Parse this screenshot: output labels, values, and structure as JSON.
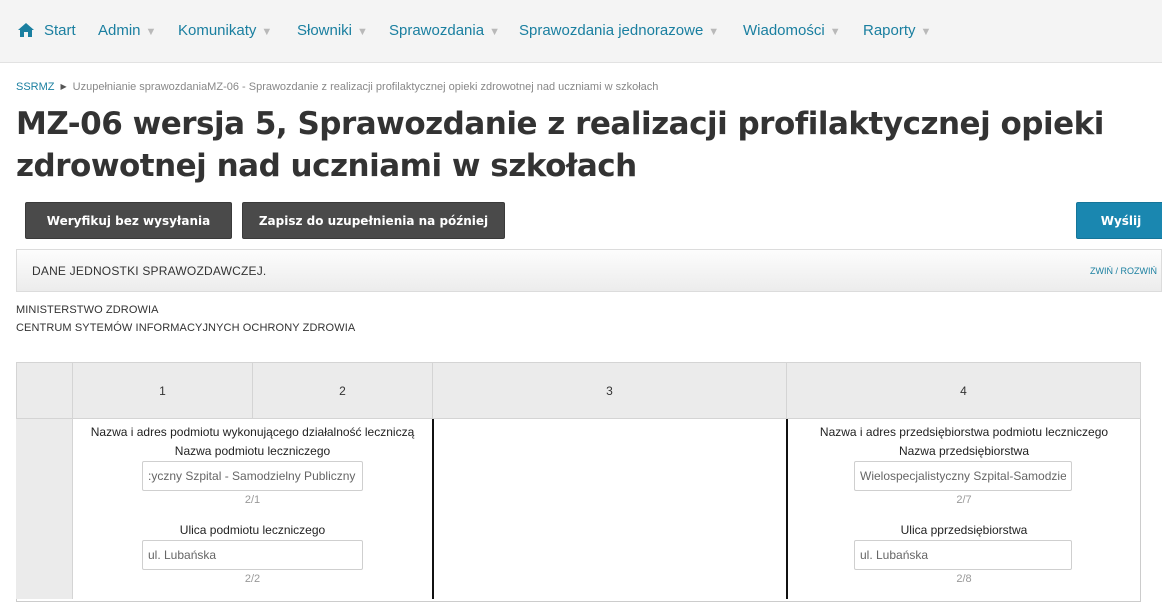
{
  "nav": {
    "home_label": "Start",
    "items": [
      {
        "label": "Admin"
      },
      {
        "label": "Komunikaty"
      },
      {
        "label": "Słowniki"
      },
      {
        "label": "Sprawozdania"
      },
      {
        "label": "Sprawozdania jednorazowe"
      },
      {
        "label": "Wiadomości"
      },
      {
        "label": "Raporty"
      }
    ]
  },
  "breadcrumb": {
    "root": "SSRMZ",
    "current": "Uzupełnianie sprawozdaniaMZ-06 - Sprawozdanie z realizacji profilaktycznej opieki zdrowotnej nad uczniami w szkołach"
  },
  "page_title": "MZ-06 wersja 5, Sprawozdanie z realizacji profilaktycznej opieki zdrowotnej nad uczniami w szkołach",
  "buttons": {
    "verify": "Weryfikuj bez wysyłania",
    "save_later": "Zapisz do uzupełnienia na później",
    "send": "Wyślij"
  },
  "section": {
    "title": "DANE JEDNOSTKI SPRAWOZDAWCZEJ.",
    "toggle": "ZWIŃ / ROZWIŃ"
  },
  "organization": {
    "line1": "MINISTERSTWO ZDROWIA",
    "line2": "CENTRUM SYTEMÓW INFORMACYJNYCH OCHRONY ZDROWIA"
  },
  "table": {
    "headers": [
      "1",
      "2",
      "3",
      "4"
    ],
    "left": {
      "heading": "Nazwa i adres podmiotu wykonującego działalność leczniczą",
      "fields": [
        {
          "label": "Nazwa podmiotu leczniczego",
          "value": ":yczny Szpital - Samodzielny Publiczny",
          "code": "2/1"
        },
        {
          "label": "Ulica podmiotu leczniczego",
          "value": "ul. Lubańska",
          "code": "2/2"
        }
      ]
    },
    "right": {
      "heading": "Nazwa i adres przedsiębiorstwa podmiotu leczniczego",
      "fields": [
        {
          "label": "Nazwa przedsiębiorstwa",
          "value": "Wielospecjalistyczny Szpital-Samodzie",
          "code": "2/7"
        },
        {
          "label": "Ulica pprzedsiębiorstwa",
          "value": "ul. Lubańska",
          "code": "2/8"
        }
      ]
    }
  },
  "icons": {
    "home": "home-icon"
  },
  "colors": {
    "link": "#1a7fa0",
    "primary": "#1a87b0",
    "dark_button": "#4a4a4a"
  }
}
